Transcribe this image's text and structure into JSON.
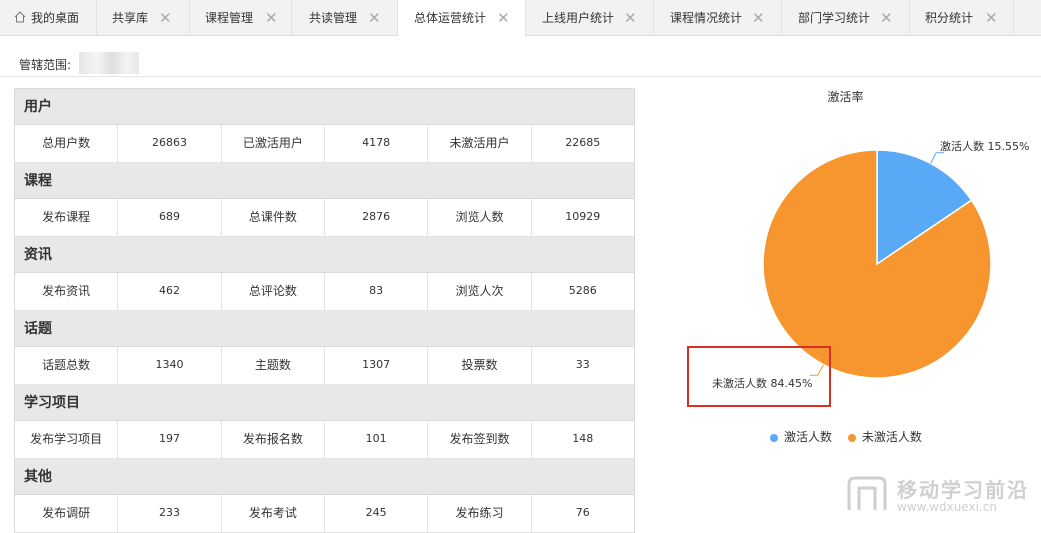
{
  "tabs": [
    {
      "label": "我的桌面",
      "icon": "home-icon"
    },
    {
      "label": "共享库"
    },
    {
      "label": "课程管理"
    },
    {
      "label": "共读管理"
    },
    {
      "label": "总体运营统计",
      "active": true
    },
    {
      "label": "上线用户统计"
    },
    {
      "label": "课程情况统计"
    },
    {
      "label": "部门学习统计"
    },
    {
      "label": "积分统计"
    }
  ],
  "tab_close_glyph": "✕",
  "scope": {
    "label": "管辖范围:"
  },
  "sections": [
    {
      "title": "用户",
      "cells": [
        "总用户数",
        "26863",
        "已激活用户",
        "4178",
        "未激活用户",
        "22685"
      ]
    },
    {
      "title": "课程",
      "cells": [
        "发布课程",
        "689",
        "总课件数",
        "2876",
        "浏览人数",
        "10929"
      ]
    },
    {
      "title": "资讯",
      "cells": [
        "发布资讯",
        "462",
        "总评论数",
        "83",
        "浏览人次",
        "5286"
      ]
    },
    {
      "title": "话题",
      "cells": [
        "话题总数",
        "1340",
        "主题数",
        "1307",
        "投票数",
        "33"
      ]
    },
    {
      "title": "学习项目",
      "cells": [
        "发布学习项目",
        "197",
        "发布报名数",
        "101",
        "发布签到数",
        "148"
      ]
    },
    {
      "title": "其他",
      "cells": [
        "发布调研",
        "233",
        "发布考试",
        "245",
        "发布练习",
        "76"
      ]
    }
  ],
  "chart_data": {
    "type": "pie",
    "title": "激活率",
    "slices": [
      {
        "name": "激活人数",
        "value": 15.55,
        "label": "激活人数 15.55%",
        "color": "#5aa9f6"
      },
      {
        "name": "未激活人数",
        "value": 84.45,
        "label": "未激活人数 84.45%",
        "color": "#f7962f"
      }
    ],
    "legend": [
      "激活人数",
      "未激活人数"
    ],
    "legend_position": "bottom"
  },
  "watermark": {
    "title": "移动学习前沿",
    "url": "www.wdxuexi.cn"
  },
  "colors": {
    "active_user": "#5aa9f6",
    "inactive_user": "#f7962f",
    "highlight_box": "#d93025"
  }
}
